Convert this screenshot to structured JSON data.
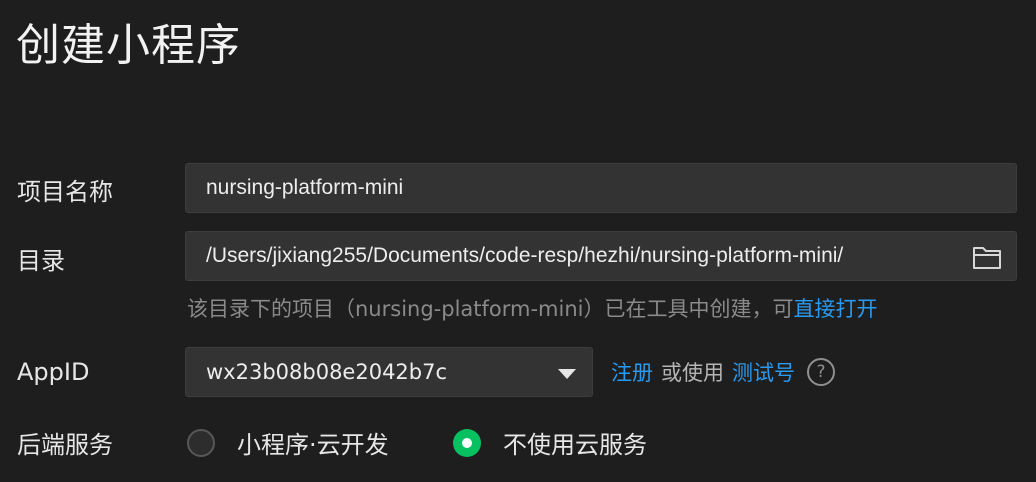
{
  "page": {
    "title": "创建小程序"
  },
  "form": {
    "project_name": {
      "label": "项目名称",
      "value": "nursing-platform-mini"
    },
    "directory": {
      "label": "目录",
      "value": "/Users/jixiang255/Documents/code-resp/hezhi/nursing-platform-mini/",
      "icon": "folder-icon",
      "hint_text": "该目录下的项目（nursing-platform-mini）已在工具中创建，可",
      "hint_link": "直接打开"
    },
    "appid": {
      "label": "AppID",
      "value": "wx23b08b08e2042b7c",
      "register_link": "注册",
      "or_use": "或使用",
      "test_link": "测试号",
      "help_icon_glyph": "?"
    },
    "backend": {
      "label": "后端服务",
      "options": [
        {
          "label": "小程序·云开发",
          "selected": false
        },
        {
          "label": "不使用云服务",
          "selected": true
        }
      ]
    }
  },
  "colors": {
    "background": "#1e1e1e",
    "field_background": "#333333",
    "link": "#2a9af0",
    "radio_selected": "#07c160",
    "hint": "#8a8a8a"
  }
}
